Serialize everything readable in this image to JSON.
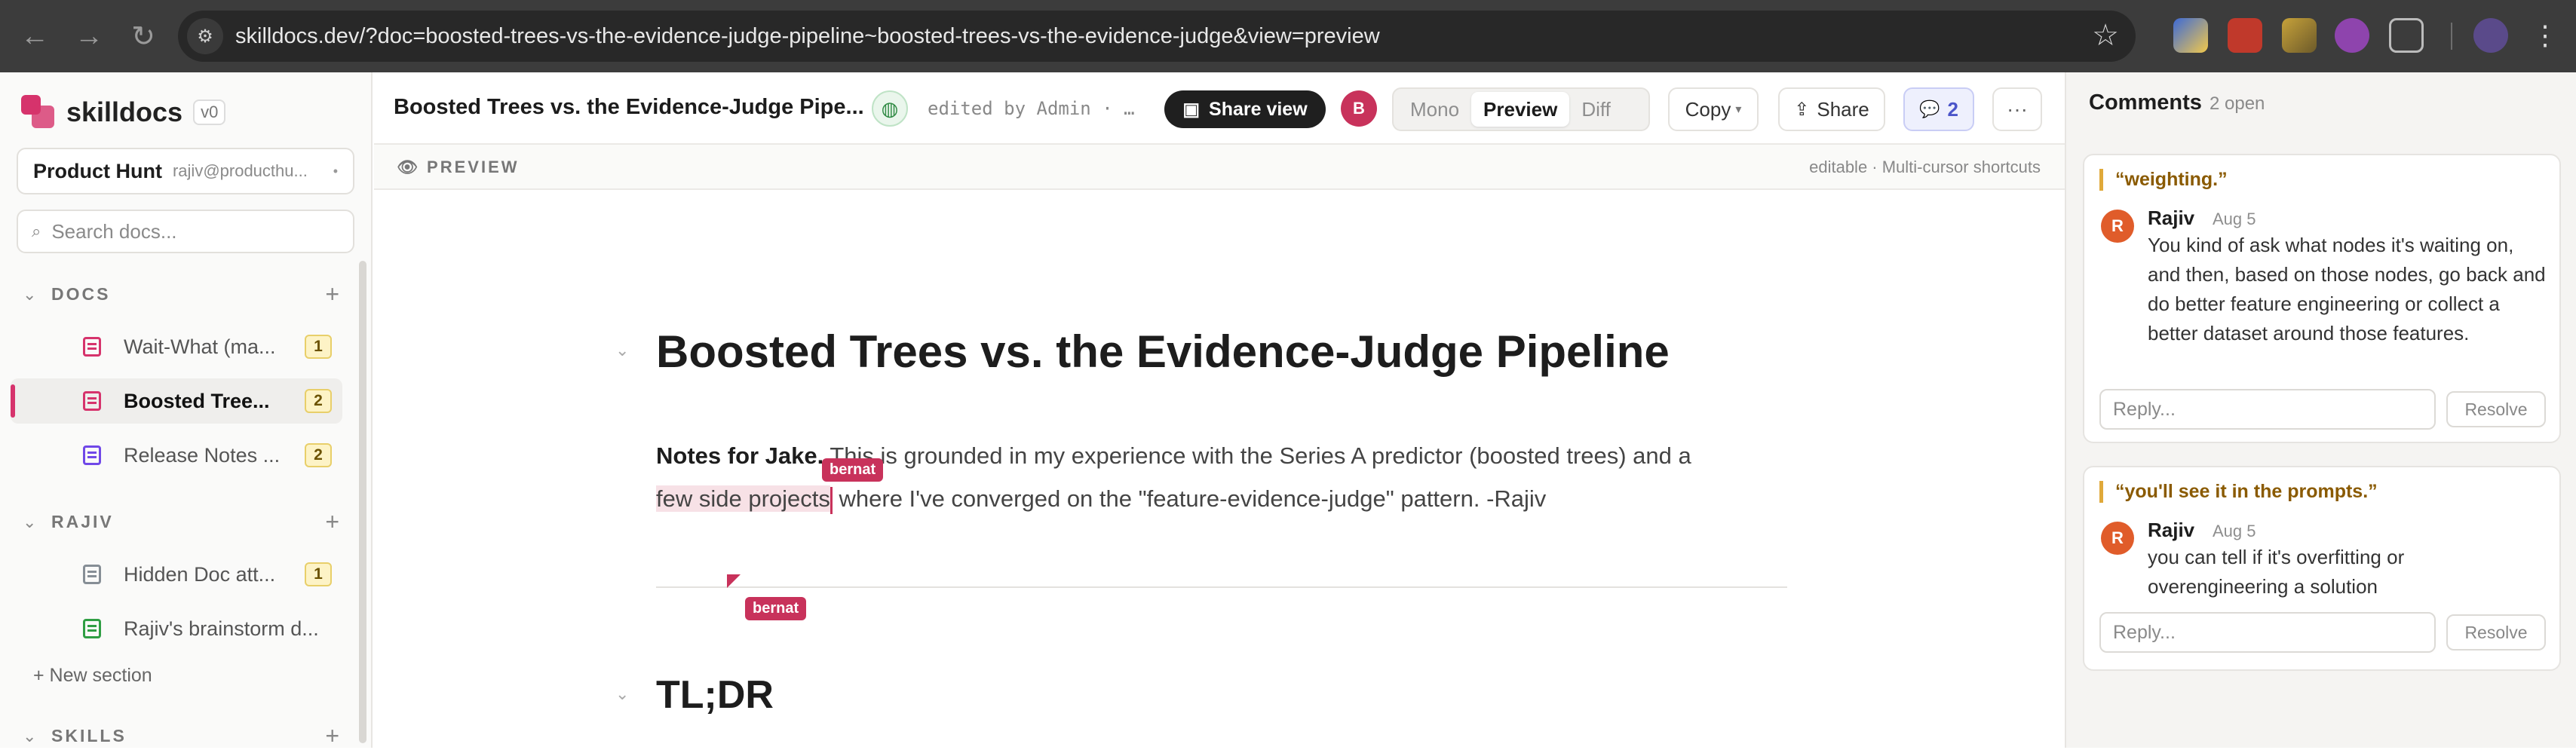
{
  "browser": {
    "url": "skilldocs.dev/?doc=boosted-trees-vs-the-evidence-judge-pipeline~boosted-trees-vs-the-evidence-judge&view=preview",
    "back_icon": "←",
    "forward_icon": "→",
    "reload_icon": "↻",
    "star_icon": "☆",
    "site_icon": "⚙"
  },
  "sidebar": {
    "brand": "skilldocs",
    "version": "v0",
    "workspace": "Product Hunt",
    "email": "rajiv@producthu...",
    "workspace_menu": "•",
    "search_placeholder": "Search docs...",
    "sections": [
      {
        "label": "DOCS",
        "items": [
          {
            "label": "Wait-What (ma...",
            "count": "1",
            "color": "#d6336c"
          },
          {
            "label": "Boosted Tree...",
            "count": "2",
            "color": "#d6336c",
            "active": true
          },
          {
            "label": "Release Notes ...",
            "count": "2",
            "color": "#7048e8"
          }
        ]
      },
      {
        "label": "RAJIV",
        "items": [
          {
            "label": "Hidden Doc att...",
            "count": "1",
            "color": "#868e96"
          },
          {
            "label": "Rajiv's brainstorm d...",
            "count": "",
            "color": "#2f9e44"
          }
        ]
      },
      {
        "label": "SKILLS",
        "items": []
      }
    ],
    "new_section": "+ New section"
  },
  "toolbar": {
    "title": "Boosted Trees vs. the Evidence-Judge Pipe...",
    "edited": "edited by Admin · …",
    "share_view": "Share view",
    "avatar": "B",
    "modes": [
      "Mono",
      "Preview",
      "Diff"
    ],
    "active_mode": "Preview",
    "copy": "Copy",
    "share": "Share",
    "comment_count": "2",
    "more": "···"
  },
  "preview_bar": {
    "label": "PREVIEW",
    "hint": "editable · Multi-cursor shortcuts"
  },
  "document": {
    "h1": "Boosted Trees vs. the Evidence-Judge Pipeline",
    "para_bold": "Notes for Jake.",
    "para_1": " This is grounded in my experience with the Series A predictor (boosted trees) and a",
    "para_hl": "few side projects",
    "para_2": " where I've converged on the \"feature-evidence-judge\" pattern. -Rajiv",
    "cursor_user": "bernat",
    "h2": "TL;DR"
  },
  "comments": {
    "title": "Comments",
    "open": "2 open",
    "threads": [
      {
        "quote": "“weighting.”",
        "initial": "R",
        "author": "Rajiv",
        "date": "Aug 5",
        "text": "You kind of ask what nodes it's waiting on, and then, based on those nodes, go back and do better feature engineering or collect a better dataset around those features.",
        "reply": "Reply...",
        "resolve": "Resolve"
      },
      {
        "quote": "“you'll see it in the prompts.”",
        "initial": "R",
        "author": "Rajiv",
        "date": "Aug 5",
        "text": "you can tell if it's overfitting or overengineering a solution",
        "reply": "Reply...",
        "resolve": "Resolve"
      }
    ]
  },
  "colors": {
    "accent": "#d6336c",
    "cursor": "#c8325b",
    "badge": "#fdf3c6"
  }
}
